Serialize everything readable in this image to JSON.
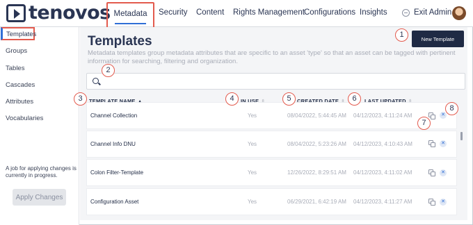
{
  "brand": {
    "name": "tenovos"
  },
  "nav": {
    "items": [
      "Metadata",
      "Security",
      "Content",
      "Rights Management",
      "Configurations",
      "Insights"
    ],
    "exit_label": "Exit Admin"
  },
  "sidebar": {
    "items": [
      "Templates",
      "Groups",
      "Tables",
      "Cascades",
      "Attributes",
      "Vocabularies"
    ],
    "note": "A job for applying changes is currently in progress.",
    "apply_label": "Apply Changes"
  },
  "page": {
    "title": "Templates",
    "description": "Metadata templates group metadata attributes that are specific to an asset 'type' so that an asset can be tagged with pertinent information for searching, filtering and organization.",
    "new_button": "New Template"
  },
  "search": {
    "placeholder": "",
    "value": ""
  },
  "table": {
    "columns": [
      "TEMPLATE NAME",
      "IN USE",
      "CREATED DATE",
      "LAST UPDATED"
    ],
    "rows": [
      {
        "name": "Channel Collection",
        "in_use": "Yes",
        "created": "08/04/2022, 5:44:45 AM",
        "updated": "04/12/2023, 4:11:24 AM"
      },
      {
        "name": "Channel Info DNU",
        "in_use": "Yes",
        "created": "08/04/2022, 5:23:26 AM",
        "updated": "04/12/2023, 4:10:43 AM"
      },
      {
        "name": "Colon Filter-Template",
        "in_use": "Yes",
        "created": "12/26/2022, 8:29:51 AM",
        "updated": "04/12/2023, 4:11:02 AM"
      },
      {
        "name": "Configuration Asset",
        "in_use": "Yes",
        "created": "06/29/2021, 6:42:19 AM",
        "updated": "04/12/2023, 4:11:27 AM"
      }
    ]
  },
  "callouts": [
    "1",
    "2",
    "3",
    "4",
    "5",
    "6",
    "7",
    "8"
  ],
  "colors": {
    "accent": "#2f6fd6",
    "highlight": "#e35a4d",
    "primary_button": "#1f2a44"
  }
}
